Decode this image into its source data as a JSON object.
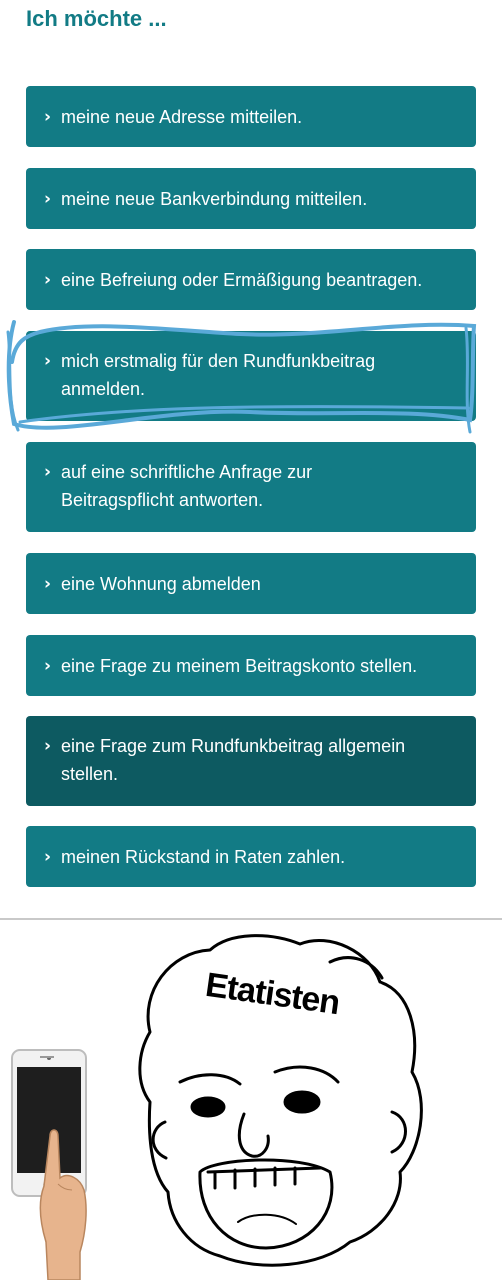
{
  "heading": "Ich möchte ...",
  "options": [
    {
      "label": "meine neue Adresse mitteilen."
    },
    {
      "label": "meine neue Bankverbindung mitteilen."
    },
    {
      "label": "eine Befreiung oder Ermäßigung beantragen."
    },
    {
      "label": "mich erstmalig für den Rundfunkbeitrag anmelden."
    },
    {
      "label": "auf eine schriftliche Anfrage zur Beitragspflicht antworten."
    },
    {
      "label": "eine Wohnung abmelden"
    },
    {
      "label": "eine Frage zu meinem Beitragskonto stellen."
    },
    {
      "label": "eine Frage zum Rundfunkbeitrag allgemein stellen."
    },
    {
      "label": "meinen Rückstand in Raten zahlen."
    }
  ],
  "chevron": "›",
  "meme": {
    "label": "Etatisten",
    "icons": [
      "smartphone-icon",
      "pointing-hand-icon",
      "genius-face-icon"
    ]
  },
  "colors": {
    "button": "#127b85",
    "button_active": "#0d5a61",
    "heading": "#127b85",
    "scribble": "#5aa9d8"
  }
}
